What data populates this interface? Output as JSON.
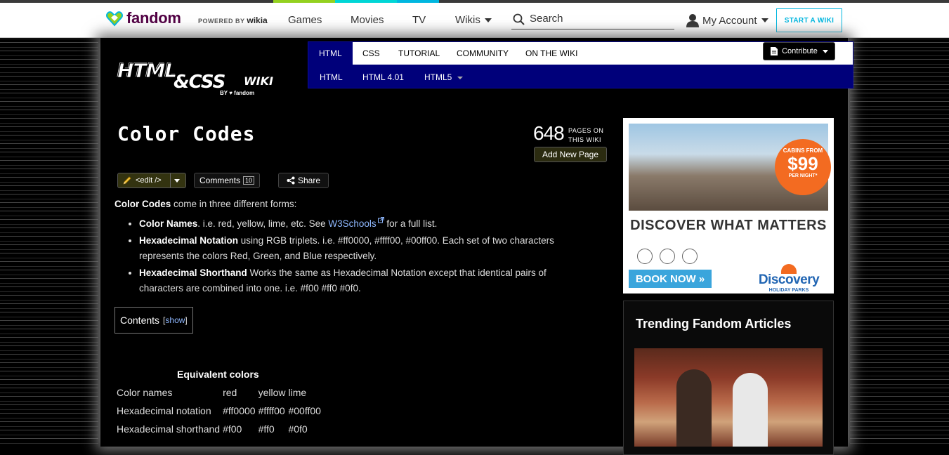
{
  "global_nav": {
    "logo_text": "fandom",
    "powered_by": "POWERED BY",
    "powered_brand": "wikia",
    "links": [
      "Games",
      "Movies",
      "TV"
    ],
    "wikis_label": "Wikis",
    "search_placeholder": "Search",
    "account_label": "My Account",
    "start_wiki_label": "START A WIKI"
  },
  "wiki_header": {
    "logo_line1": "HTML",
    "logo_line2": "&CSS",
    "logo_line3": "WIKI",
    "logo_by": "BY ♥ fandom",
    "tabs": [
      "HTML",
      "CSS",
      "TUTORIAL",
      "COMMUNITY",
      "ON THE WIKI"
    ],
    "subtabs": [
      "HTML",
      "HTML 4.01",
      "HTML5"
    ],
    "contribute_label": "Contribute"
  },
  "page": {
    "title": "Color Codes",
    "page_count": "648",
    "page_count_label": "PAGES ON THIS WIKI",
    "add_page_label": "Add New Page",
    "edit_label": "<edit />",
    "comments_label": "Comments",
    "comments_count": "10",
    "share_label": "Share"
  },
  "article": {
    "intro_bold": "Color Codes",
    "intro_rest": " come in three different forms:",
    "items": [
      {
        "bold": "Color Names",
        "text_before_link": ". i.e. red, yellow, lime, etc. See ",
        "link": "W3Schools",
        "text_after_link": " for a full list."
      },
      {
        "bold": "Hexadecimal Notation",
        "text": " using RGB triplets. i.e. #ff0000, #ffff00, #00ff00. Each set of two characters represents the colors Red, Green, and Blue respectively."
      },
      {
        "bold": "Hexadecimal Shorthand",
        "text": " Works the same as Hexadecimal Notation except that identical pairs of characters are combined into one. i.e. #f00 #ff0 #0f0."
      }
    ],
    "toc_label": "Contents",
    "toc_show": "show"
  },
  "equivalent_table": {
    "title": "Equivalent colors",
    "rows": [
      [
        "Color names",
        "red",
        "yellow",
        "lime"
      ],
      [
        "Hexadecimal notation",
        "#ff0000",
        "#ffff00",
        "#00ff00"
      ],
      [
        "Hexadecimal shorthand",
        "#f00",
        "#ff0",
        "#0f0"
      ]
    ]
  },
  "ad": {
    "badge_top": "CABINS FROM",
    "badge_price": "$99",
    "badge_bottom": "PER NIGHT*",
    "headline": "DISCOVER WHAT MATTERS",
    "book_label": "BOOK NOW »",
    "brand": "Discovery",
    "brand_sub": "HOLIDAY PARKS"
  },
  "trending": {
    "title": "Trending Fandom Articles"
  },
  "colors": {
    "fandom_purple": "#520044",
    "fandom_teal": "#00b7e0",
    "wiki_nav_blue": "#00007a",
    "link_blue": "#8fb8ff"
  }
}
